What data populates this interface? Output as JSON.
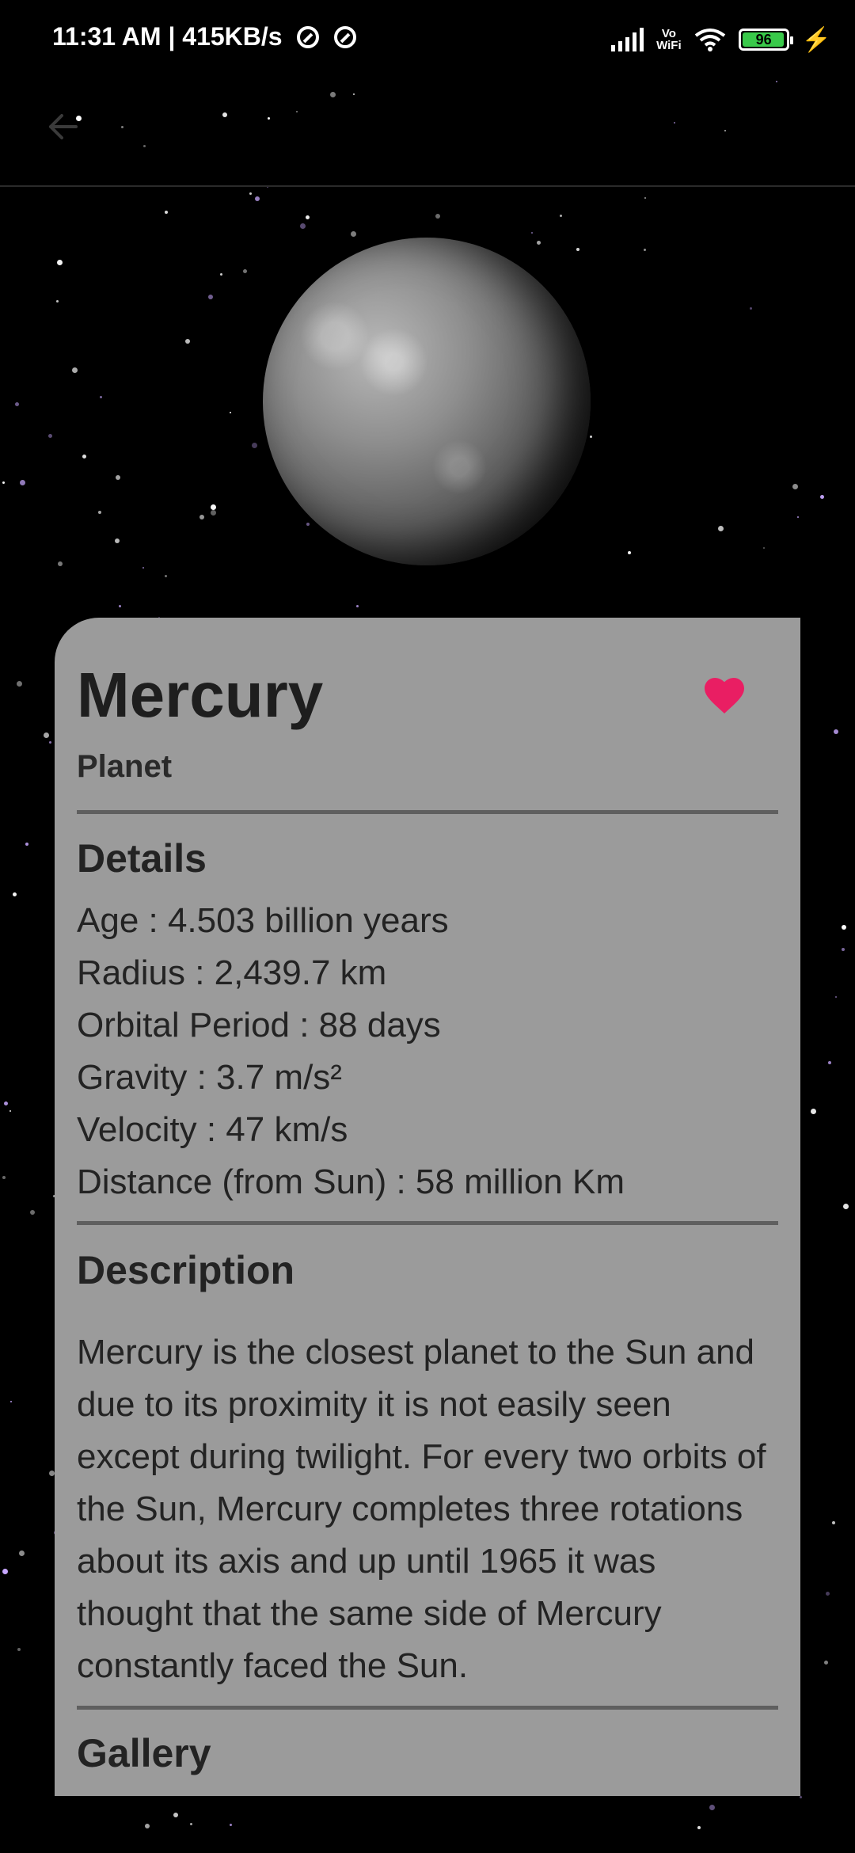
{
  "status_bar": {
    "time": "11:31 AM | 415KB/s",
    "vowifi": [
      "Vo",
      "WiFi"
    ],
    "battery": "96"
  },
  "app_bar": {
    "back_icon": "arrow-left-icon"
  },
  "planet": {
    "name": "Mercury",
    "type": "Planet",
    "favorite_icon": "heart-icon",
    "favorite_color": "#e91e63"
  },
  "sections": {
    "details_title": "Details",
    "details": [
      "Age : 4.503 billion years",
      "Radius : 2,439.7 km",
      "Orbital Period : 88 days",
      "Gravity : 3.7 m/s²",
      "Velocity : 47 km/s",
      "Distance (from Sun) : 58 million Km"
    ],
    "description_title": "Description",
    "description": "Mercury is the closest planet to the Sun and due to its proximity it is not easily seen except during twilight. For every two orbits of the Sun, Mercury completes three rotations about its axis and up until 1965 it was thought that the same side of Mercury constantly faced the Sun.",
    "gallery_title": "Gallery"
  }
}
